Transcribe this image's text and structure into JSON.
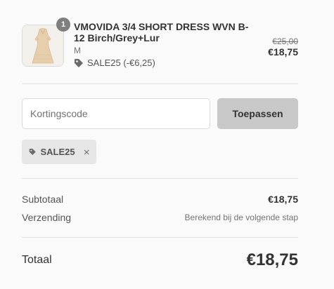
{
  "line_item": {
    "quantity": "1",
    "title": "VMOVIDA 3/4 SHORT DRESS WVN B-12 Birch/Grey+Lur",
    "variant": "M",
    "discount_label": "SALE25 (-€6,25)",
    "price_original": "€25,00",
    "price_current": "€18,75",
    "image_icon": "product-photo-dress"
  },
  "discount_form": {
    "placeholder": "Kortingscode",
    "value": "",
    "apply_label": "Toepassen"
  },
  "applied_discount": {
    "code": "SALE25"
  },
  "summary": {
    "subtotal_label": "Subtotaal",
    "subtotal_value": "€18,75",
    "shipping_label": "Verzending",
    "shipping_value": "Berekend bij de volgende stap",
    "total_label": "Totaal",
    "total_value": "€18,75"
  },
  "colors": {
    "background": "#fafafa",
    "badge": "#7f7f7f",
    "button_disabled": "#c8c8c8",
    "tag_bg": "#e6e6e6"
  }
}
